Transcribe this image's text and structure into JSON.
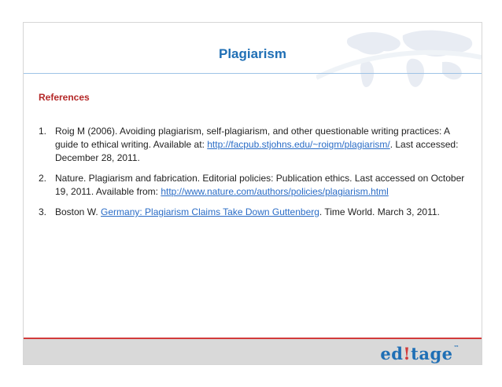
{
  "slide": {
    "title": "Plagiarism",
    "references_heading": "References"
  },
  "references": [
    {
      "number": "1.",
      "text_before": "Roig M (2006). Avoiding plagiarism, self-plagiarism, and other questionable writing practices: A guide to ethical writing. Available at: ",
      "link": "http://facpub.stjohns.edu/~roigm/plagiarism/",
      "text_after": ". Last accessed: December 28, 2011."
    },
    {
      "number": "2.",
      "text_before": "Nature. Plagiarism and fabrication. Editorial policies: Publication ethics. Last accessed on October 19, 2011. Available from: ",
      "link": "http://www.nature.com/authors/policies/plagiarism.html",
      "text_after": ""
    },
    {
      "number": "3.",
      "text_before": "Boston W. ",
      "link": "Germany: Plagiarism Claims Take Down Guttenberg",
      "text_after": ". Time World. March 3, 2011."
    }
  ],
  "footer": {
    "logo_prefix": "ed",
    "logo_mark": "!",
    "logo_suffix": "tage",
    "logo_tm": "™"
  },
  "colors": {
    "title": "#1f6fb5",
    "heading": "#b42828",
    "link": "#2a6cc6",
    "footer_accent": "#d23b3b"
  }
}
